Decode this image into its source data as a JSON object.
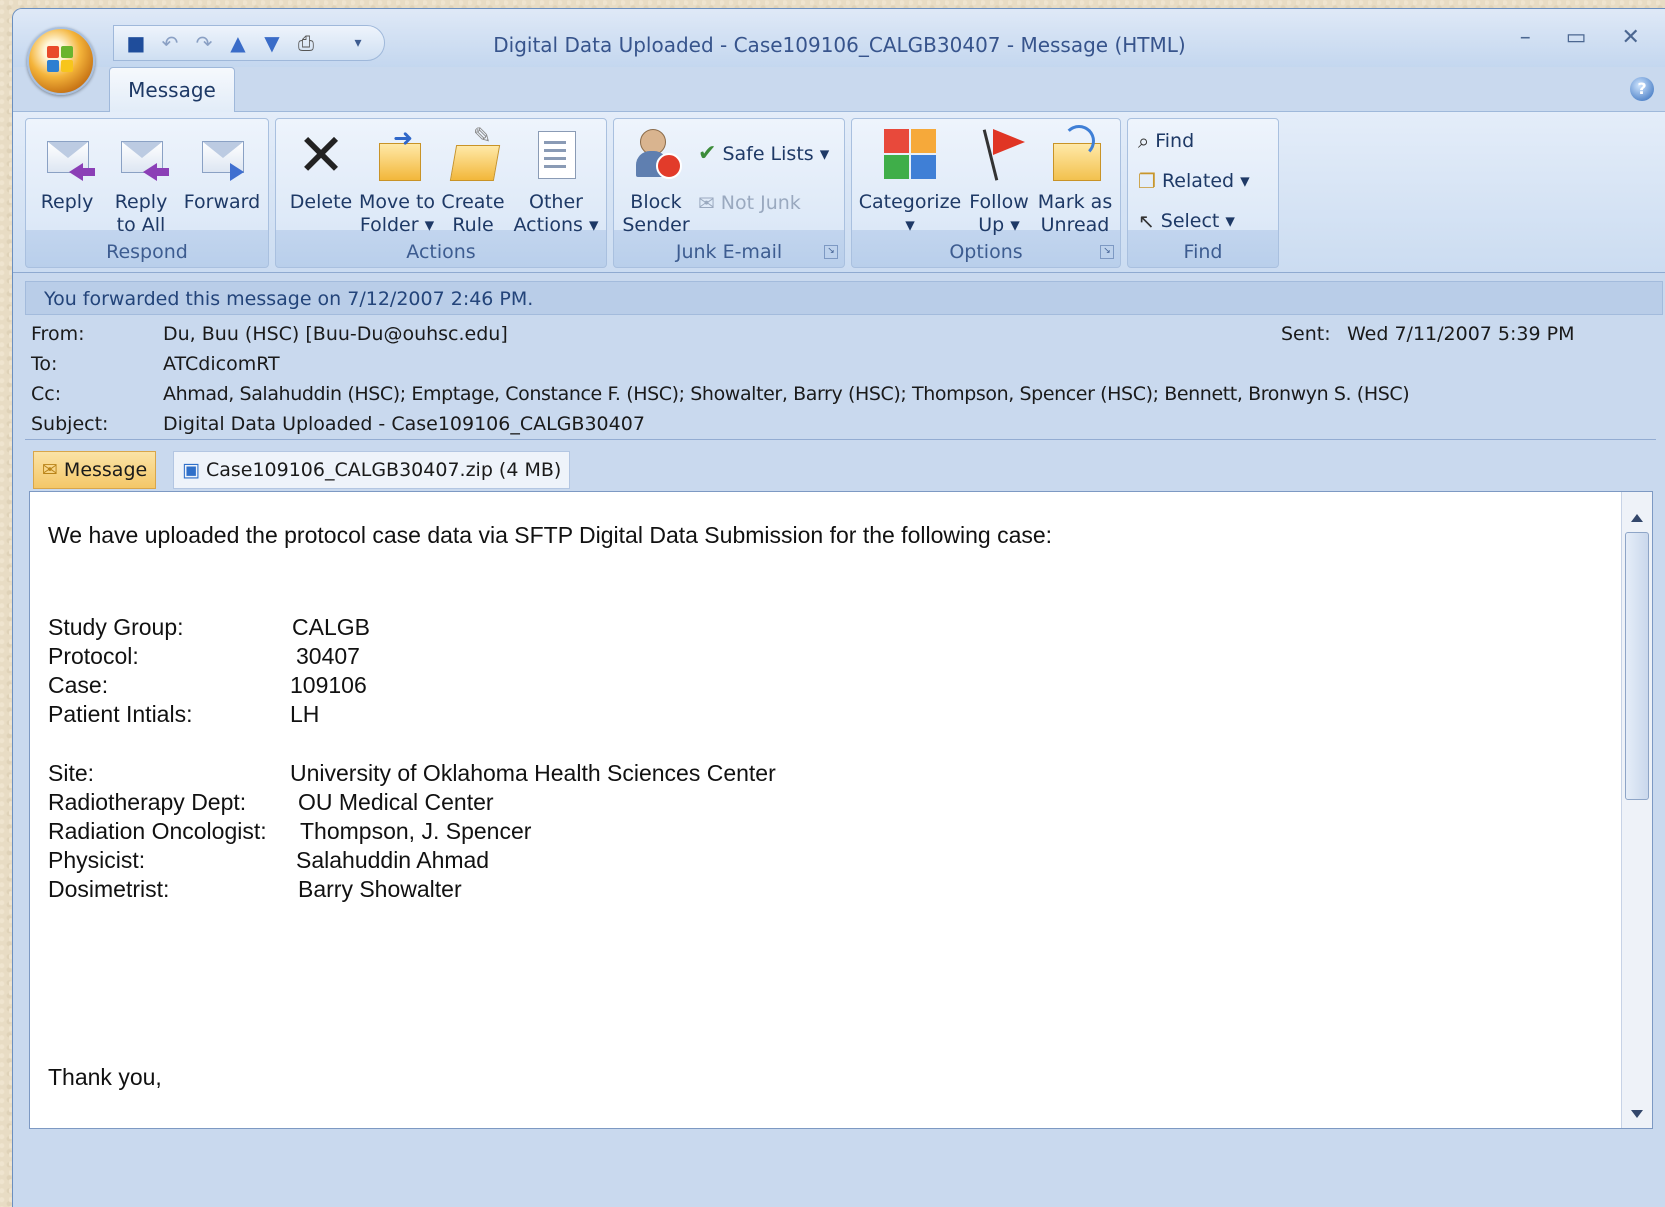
{
  "window": {
    "title": "Digital Data Uploaded - Case109106_CALGB30407 - Message (HTML)",
    "controls": "– ▭ ✕",
    "help": "?"
  },
  "tabs": {
    "active": "Message"
  },
  "ribbon": {
    "respond": {
      "label": "Respond",
      "reply": "Reply",
      "reply_all_1": "Reply",
      "reply_all_2": "to All",
      "forward": "Forward"
    },
    "actions": {
      "label": "Actions",
      "delete": "Delete",
      "move_1": "Move to",
      "move_2": "Folder ▾",
      "create_1": "Create",
      "create_2": "Rule",
      "other_1": "Other",
      "other_2": "Actions ▾"
    },
    "junk": {
      "label": "Junk E-mail",
      "block_1": "Block",
      "block_2": "Sender",
      "safe_lists": "Safe Lists ▾",
      "not_junk": "Not Junk"
    },
    "options": {
      "label": "Options",
      "categorize_1": "Categorize",
      "categorize_2": "▾",
      "follow_1": "Follow",
      "follow_2": "Up ▾",
      "mark_1": "Mark as",
      "mark_2": "Unread"
    },
    "find": {
      "label": "Find",
      "find": "Find",
      "related": "Related ▾",
      "select": "Select ▾"
    }
  },
  "info_bar": "You forwarded this message on 7/12/2007 2:46 PM.",
  "header": {
    "from_label": "From:",
    "from": "Du, Buu  (HSC) [Buu-Du@ouhsc.edu]",
    "sent_label": "Sent:",
    "sent": "Wed 7/11/2007 5:39 PM",
    "to_label": "To:",
    "to": "ATCdicomRT",
    "cc_label": "Cc:",
    "cc": "Ahmad, Salahuddin  (HSC); Emptage, Constance F. (HSC); Showalter, Barry  (HSC); Thompson, Spencer  (HSC); Bennett, Bronwyn S. (HSC)",
    "subject_label": "Subject:",
    "subject": "Digital Data Uploaded - Case109106_CALGB30407"
  },
  "attachments": {
    "message": "Message",
    "file": "Case109106_CALGB30407.zip (4 MB)"
  },
  "body": {
    "intro": "We have uploaded  the protocol case data via SFTP Digital Data Submission for the following case:",
    "fields": [
      {
        "label": "Study Group:",
        "value": "CALGB"
      },
      {
        "label": "Protocol:",
        "value": "30407"
      },
      {
        "label": "Case:",
        "value": "109106"
      },
      {
        "label": "Patient Intials:",
        "value": "LH"
      },
      {
        "label": "Site:",
        "value": "University of Oklahoma Health Sciences Center"
      },
      {
        "label": "Radiotherapy Dept:",
        "value": "OU Medical Center"
      },
      {
        "label": "Radiation Oncologist:",
        "value": "Thompson, J. Spencer"
      },
      {
        "label": "Physicist:",
        "value": "Salahuddin Ahmad"
      },
      {
        "label": "Dosimetrist:",
        "value": "Barry Showalter"
      }
    ],
    "closing": "Thank you,"
  }
}
